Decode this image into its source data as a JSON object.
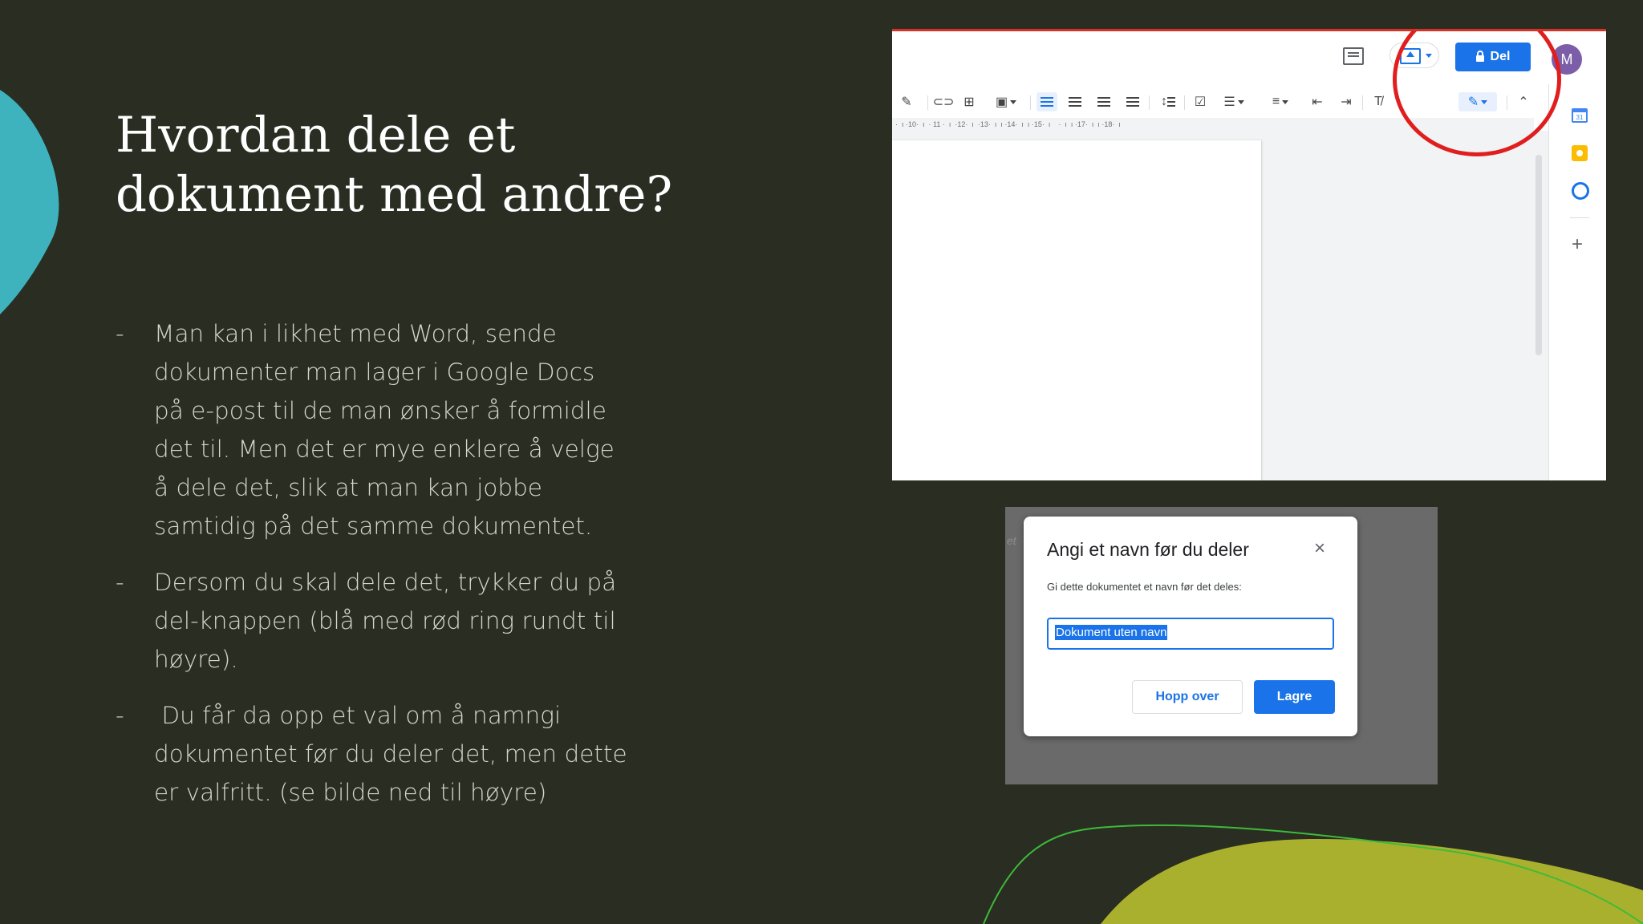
{
  "slide": {
    "title": "Hvordan dele et dokument med andre?",
    "bullets": [
      {
        "marker": "-",
        "text": "Man kan i likhet med Word, sende dokumenter man lager i Google Docs på e-post til de man ønsker å formidle det til. Men det er mye enklere å velge å dele det, slik at man kan jobbe samtidig på det samme dokumentet."
      },
      {
        "marker": "-",
        "text": "Dersom du skal dele det, trykker du på del-knappen (blå med rød ring rundt til høyre)."
      },
      {
        "marker": "-",
        "text": " Du får da opp et val om å namngi dokumentet før du deler det, men dette er valfritt. (se bilde ned til høyre)"
      }
    ],
    "colors": {
      "background": "#2a2d22",
      "teal_shape": "#3fb3bd",
      "olive_shape": "#a9b02e",
      "green_line": "#3dbb3a"
    }
  },
  "docs_screenshot": {
    "share_button_label": "Del",
    "avatar_initial": "M",
    "ruler_text": "·  ı ·10·  ı  · 11 ·  ı  ·12·  ı  ·13·  ı  ı ·14·  ı  ı ·15·  ı    ·  ı  ı ·17·  ı  ı ·18·  ı",
    "calendar_day": "31",
    "icons": [
      "comment-history-icon",
      "present-icon",
      "lock-icon",
      "paint-format-icon",
      "link-icon",
      "add-comment-icon",
      "image-icon",
      "align-left-icon",
      "align-center-icon",
      "align-right-icon",
      "justify-icon",
      "line-spacing-icon",
      "checklist-icon",
      "bullet-list-icon",
      "numbered-list-icon",
      "decrease-indent-icon",
      "increase-indent-icon",
      "clear-formatting-icon",
      "editing-mode-icon",
      "collapse-icon",
      "calendar-icon",
      "keep-icon",
      "tasks-icon",
      "add-icon"
    ]
  },
  "dialog": {
    "ghost_text": "et",
    "title": "Angi et navn før du deler",
    "close_symbol": "×",
    "description": "Gi dette dokumentet et navn før det deles:",
    "input_value": "Dokument uten navn",
    "skip_label": "Hopp over",
    "save_label": "Lagre"
  }
}
